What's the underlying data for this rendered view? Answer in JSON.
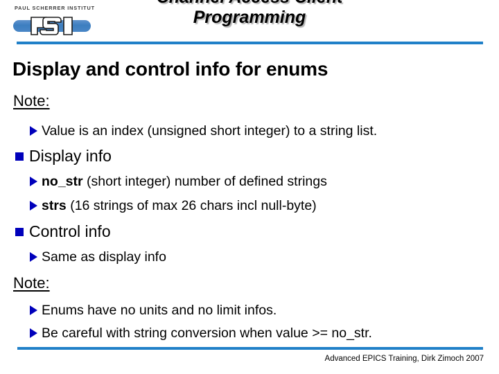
{
  "header": {
    "logo": {
      "institute_text": "PAUL SCHERRER INSTITUT",
      "mark_text": "PSI",
      "bar_color": "#3c7ec0"
    },
    "deck_title": "Channel Access Client\nProgramming"
  },
  "rules": {
    "color": "#2080c8"
  },
  "slide": {
    "heading": "Display and control info for enums",
    "note_label_1": "Note:",
    "note_label_2": "Note:",
    "bullets": {
      "value_line": "Value is an index (unsigned short integer) to a string list.",
      "display_info": "Display info",
      "no_str_term": "no_str",
      "no_str_rest": " (short integer) number of defined strings",
      "strs_term": "strs",
      "strs_rest": " (16 strings of max 26 chars incl null-byte)",
      "control_info": "Control info",
      "same_as_display": "Same as display info",
      "enums_no_units": "Enums have no units and no limit infos.",
      "be_careful": "Be careful with string conversion when value >= no_str."
    },
    "bullet_color": "#0000bb"
  },
  "footer": {
    "text": "Advanced EPICS Training, Dirk Zimoch 2007"
  }
}
